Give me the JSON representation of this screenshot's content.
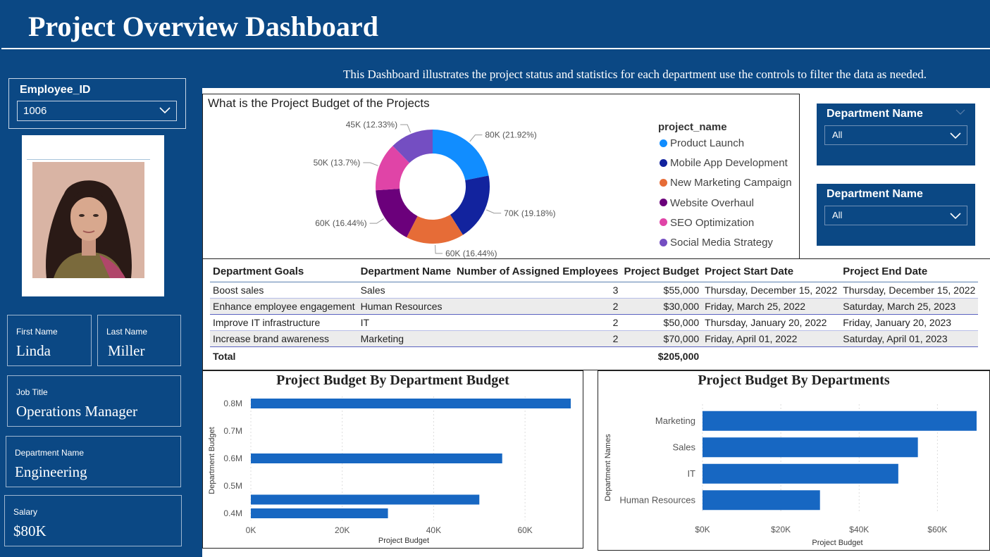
{
  "header": {
    "title": "Project Overview Dashboard",
    "subtitle": "This Dashboard illustrates the project status and statistics for each department use the controls to filter the data as needed."
  },
  "employee_slicer": {
    "label": "Employee_ID",
    "value": "1006"
  },
  "employee": {
    "first_name_label": "First Name",
    "first_name": "Linda",
    "last_name_label": "Last Name",
    "last_name": "Miller",
    "job_title_label": "Job Title",
    "job_title": "Operations Manager",
    "department_label": "Department Name",
    "department": "Engineering",
    "salary_label": "Salary",
    "salary": "$80K"
  },
  "department_slicers": [
    {
      "label": "Department Name",
      "value": "All"
    },
    {
      "label": "Department Name",
      "value": "All"
    }
  ],
  "donut": {
    "title": "What is the Project Budget of the Projects",
    "legend_title": "project_name",
    "slices": [
      {
        "name": "Product Launch",
        "value": 80,
        "label": "80K (21.92%)",
        "color": "#118DFF"
      },
      {
        "name": "Mobile App Development",
        "value": 70,
        "label": "70K (19.18%)",
        "color": "#12239E"
      },
      {
        "name": "New Marketing Campaign",
        "value": 60,
        "label": "60K (16.44%)",
        "color": "#E66C37"
      },
      {
        "name": "Website Overhaul",
        "value": 60,
        "label": "60K (16.44%)",
        "color": "#6B007B"
      },
      {
        "name": "SEO Optimization",
        "value": 50,
        "label": "50K (13.7%)",
        "color": "#E044A7"
      },
      {
        "name": "Social Media Strategy",
        "value": 45,
        "label": "45K (12.33%)",
        "color": "#744EC2"
      }
    ]
  },
  "table": {
    "columns": [
      "Department Goals",
      "Department Name",
      "Number of Assigned Employees",
      "Project Budget",
      "Project Start Date",
      "Project End Date"
    ],
    "rows": [
      [
        "Boost sales",
        "Sales",
        "3",
        "$55,000",
        "Thursday, December 15, 2022",
        "Thursday, December 15, 2022"
      ],
      [
        "Enhance employee engagement",
        "Human Resources",
        "2",
        "$30,000",
        "Friday, March 25, 2022",
        "Saturday, March 25, 2023"
      ],
      [
        "Improve IT infrastructure",
        "IT",
        "2",
        "$50,000",
        "Thursday, January 20, 2022",
        "Friday, January 20, 2023"
      ],
      [
        "Increase brand awareness",
        "Marketing",
        "2",
        "$70,000",
        "Friday, April 01, 2022",
        "Saturday, April 01, 2023"
      ]
    ],
    "total_label": "Total",
    "total_budget": "$205,000"
  },
  "chart_data": [
    {
      "type": "bar",
      "orientation": "horizontal",
      "title": "Project Budget By Department Budget",
      "xlabel": "Project Budget",
      "ylabel": "Department Budget",
      "xlim": [
        0,
        70000
      ],
      "ylim": [
        400000,
        800000
      ],
      "xticks": [
        0,
        20000,
        40000,
        60000
      ],
      "xtick_labels": [
        "0K",
        "20K",
        "40K",
        "60K"
      ],
      "yticks": [
        400000,
        500000,
        600000,
        700000,
        800000
      ],
      "ytick_labels": [
        "0.4M",
        "0.5M",
        "0.6M",
        "0.7M",
        "0.8M"
      ],
      "points": [
        {
          "y": 800000,
          "x": 70000
        },
        {
          "y": 600000,
          "x": 55000
        },
        {
          "y": 450000,
          "x": 50000
        },
        {
          "y": 400000,
          "x": 30000
        }
      ],
      "grid": true,
      "color": "#1767C2"
    },
    {
      "type": "bar",
      "orientation": "horizontal",
      "title": "Project Budget By Departments",
      "xlabel": "Project Budget",
      "ylabel": "Department Names",
      "categories": [
        "Marketing",
        "Sales",
        "IT",
        "Human Resources"
      ],
      "values": [
        70000,
        55000,
        50000,
        30000
      ],
      "xlim": [
        0,
        70000
      ],
      "xticks": [
        0,
        20000,
        40000,
        60000
      ],
      "xtick_labels": [
        "$0K",
        "$20K",
        "$40K",
        "$60K"
      ],
      "grid": true,
      "color": "#1767C2"
    }
  ]
}
